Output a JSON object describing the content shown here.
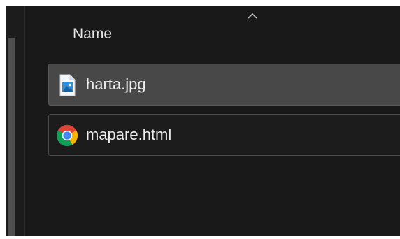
{
  "file_list": {
    "column_header": "Name",
    "sort_indicator_icon": "chevron-up-icon",
    "items": [
      {
        "name": "harta.jpg",
        "icon": "image-file-icon",
        "state": "selected"
      },
      {
        "name": "mapare.html",
        "icon": "chrome-icon",
        "state": "focused"
      }
    ]
  },
  "colors": {
    "background": "#191919",
    "selected_row": "#484848",
    "text": "#ececec"
  }
}
